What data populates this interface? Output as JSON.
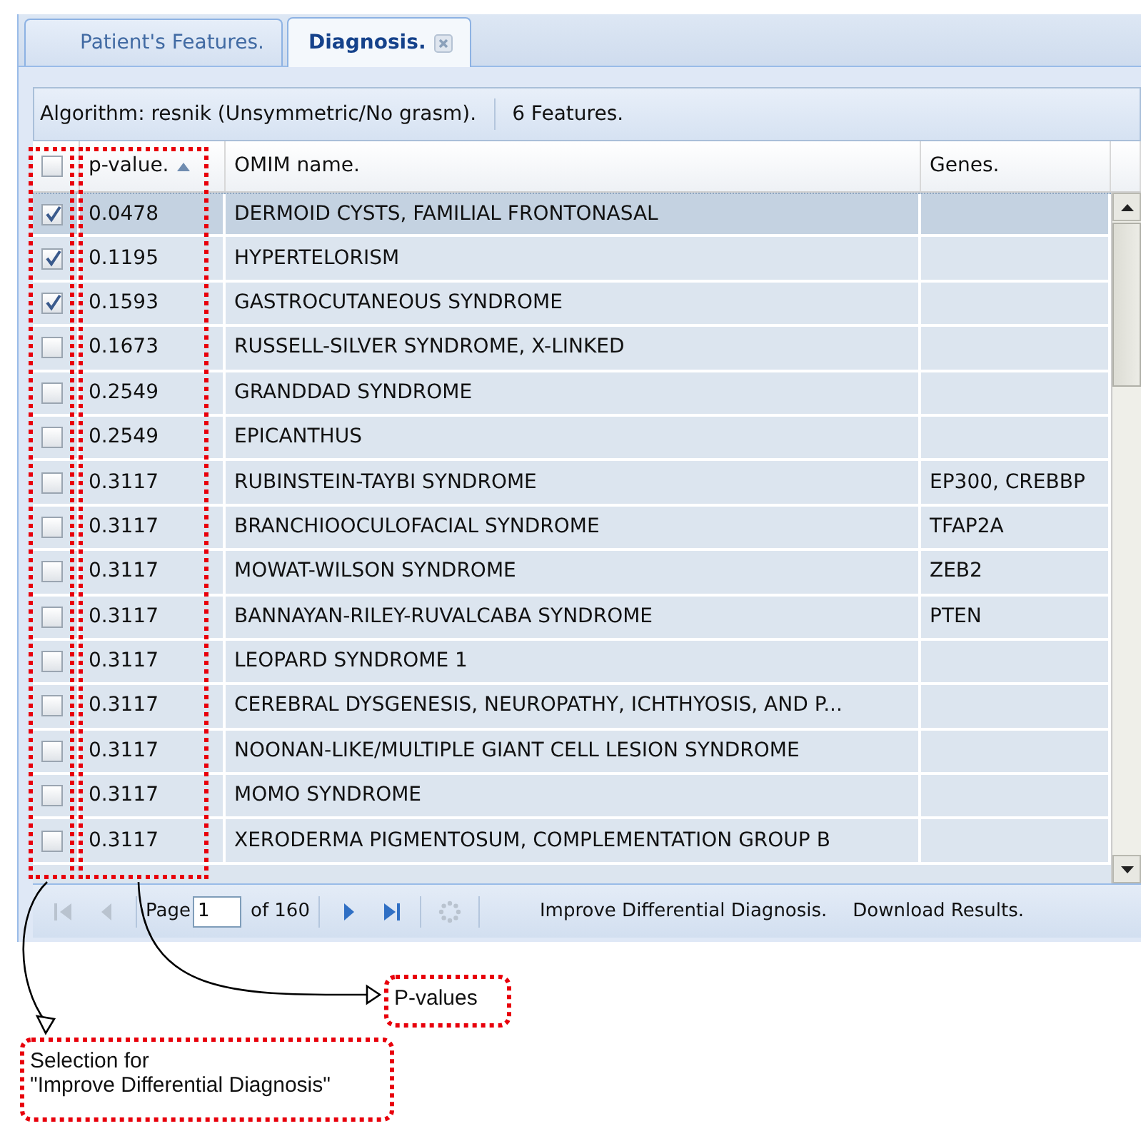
{
  "tabs": [
    {
      "label": "Patient's Features.",
      "selected": false,
      "closable": false
    },
    {
      "label": "Diagnosis.",
      "selected": true,
      "closable": true
    }
  ],
  "toolbar": {
    "algorithm": "Algorithm: resnik (Unsymmetric/No grasm).",
    "features": "6 Features."
  },
  "table": {
    "select_all_checked": false,
    "columns": [
      {
        "label": "p-value.",
        "sorted_ascending": true
      },
      {
        "label": "OMIM name.",
        "sorted_ascending": false
      },
      {
        "label": "Genes.",
        "sorted_ascending": false
      }
    ],
    "rows": [
      {
        "checked": true,
        "selected": true,
        "p_value": "0.0478",
        "name": "DERMOID CYSTS, FAMILIAL FRONTONASAL",
        "genes": ""
      },
      {
        "checked": true,
        "selected": false,
        "p_value": "0.1195",
        "name": "HYPERTELORISM",
        "genes": ""
      },
      {
        "checked": true,
        "selected": false,
        "p_value": "0.1593",
        "name": "GASTROCUTANEOUS SYNDROME",
        "genes": ""
      },
      {
        "checked": false,
        "selected": false,
        "p_value": "0.1673",
        "name": "RUSSELL-SILVER SYNDROME, X-LINKED",
        "genes": ""
      },
      {
        "checked": false,
        "selected": false,
        "p_value": "0.2549",
        "name": "GRANDDAD SYNDROME",
        "genes": ""
      },
      {
        "checked": false,
        "selected": false,
        "p_value": "0.2549",
        "name": "EPICANTHUS",
        "genes": ""
      },
      {
        "checked": false,
        "selected": false,
        "p_value": "0.3117",
        "name": "RUBINSTEIN-TAYBI SYNDROME",
        "genes": "EP300, CREBBP"
      },
      {
        "checked": false,
        "selected": false,
        "p_value": "0.3117",
        "name": "BRANCHIOOCULOFACIAL SYNDROME",
        "genes": "TFAP2A"
      },
      {
        "checked": false,
        "selected": false,
        "p_value": "0.3117",
        "name": "MOWAT-WILSON SYNDROME",
        "genes": "ZEB2"
      },
      {
        "checked": false,
        "selected": false,
        "p_value": "0.3117",
        "name": "BANNAYAN-RILEY-RUVALCABA SYNDROME",
        "genes": "PTEN"
      },
      {
        "checked": false,
        "selected": false,
        "p_value": "0.3117",
        "name": "LEOPARD SYNDROME 1",
        "genes": ""
      },
      {
        "checked": false,
        "selected": false,
        "p_value": "0.3117",
        "name": "CEREBRAL DYSGENESIS, NEUROPATHY, ICHTHYOSIS, AND P...",
        "genes": ""
      },
      {
        "checked": false,
        "selected": false,
        "p_value": "0.3117",
        "name": "NOONAN-LIKE/MULTIPLE GIANT CELL LESION SYNDROME",
        "genes": ""
      },
      {
        "checked": false,
        "selected": false,
        "p_value": "0.3117",
        "name": "MOMO SYNDROME",
        "genes": ""
      },
      {
        "checked": false,
        "selected": false,
        "p_value": "0.3117",
        "name": "XERODERMA PIGMENTOSUM, COMPLEMENTATION GROUP B",
        "genes": ""
      }
    ]
  },
  "pager": {
    "buttons_before": [
      {
        "kind": "first",
        "disabled": true
      },
      {
        "kind": "prev",
        "disabled": true
      }
    ],
    "page_label": "Page",
    "page_value": "1",
    "of_label": "of 160",
    "buttons_after": [
      {
        "kind": "next",
        "disabled": false
      },
      {
        "kind": "last",
        "disabled": false
      },
      {
        "kind": "refresh",
        "disabled": true
      }
    ],
    "actions": [
      "Improve Differential Diagnosis.",
      "Download Results."
    ]
  },
  "annotations": {
    "pvalue": "P-values",
    "checkbox": "Selection for\n\"Improve Differential Diagnosis\""
  }
}
